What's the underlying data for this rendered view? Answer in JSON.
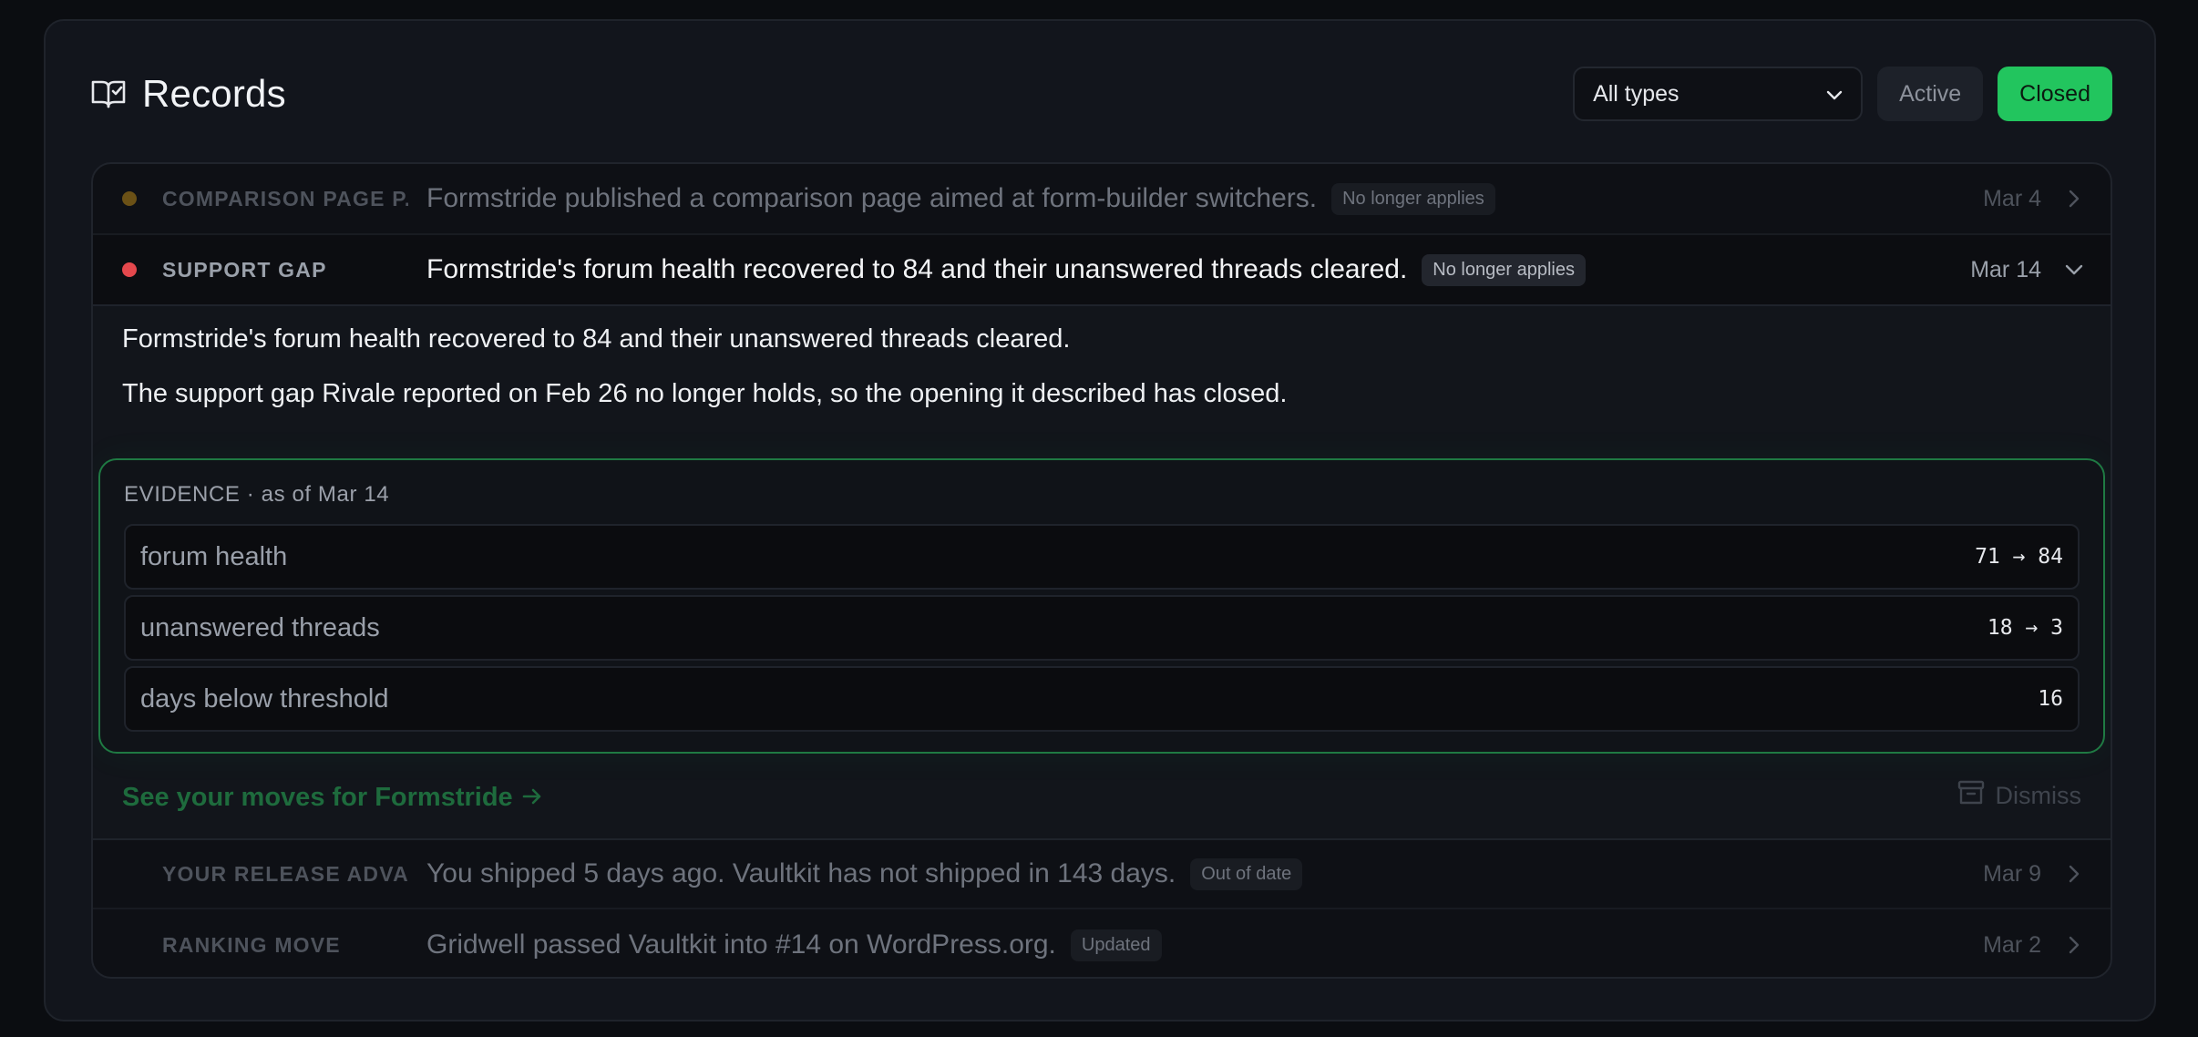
{
  "header": {
    "title": "Records",
    "icon": "book-check-icon"
  },
  "filters": {
    "type_select": "All types",
    "segments": [
      {
        "label": "Active"
      },
      {
        "label": "Closed"
      }
    ]
  },
  "colors": {
    "accent": "#22c55e",
    "dot_amber": "#7a5a17",
    "dot_red": "#e5484d"
  },
  "records": [
    {
      "category": "COMPARISON PAGE P...",
      "summary": "Formstride published a comparison page aimed at form-builder switchers.",
      "badge": "No longer applies",
      "date": "Mar 4"
    },
    {
      "category": "SUPPORT GAP",
      "summary": "Formstride's forum health recovered to 84 and their unanswered threads cleared.",
      "badge": "No longer applies",
      "date": "Mar 14"
    },
    {
      "category": "YOUR RELEASE ADVA...",
      "summary": "You shipped 5 days ago. Vaultkit has not shipped in 143 days.",
      "badge": "Out of date",
      "date": "Mar 9"
    },
    {
      "category": "RANKING MOVE",
      "summary": "Gridwell passed Vaultkit into #14 on WordPress.org.",
      "badge": "Updated",
      "date": "Mar 2"
    }
  ],
  "detail": {
    "line1": "Formstride's forum health recovered to 84 and their unanswered threads cleared.",
    "line2": "The support gap Rivale reported on Feb 26 no longer holds, so the opening it described has closed.",
    "evidence_title": "EVIDENCE · as of Mar 14",
    "metrics": [
      {
        "label": "forum health",
        "value": "71 → 84"
      },
      {
        "label": "unanswered threads",
        "value": "18 → 3"
      },
      {
        "label": "days below threshold",
        "value": "16"
      }
    ],
    "moves_link": "See your moves for Formstride",
    "dismiss": "Dismiss"
  }
}
